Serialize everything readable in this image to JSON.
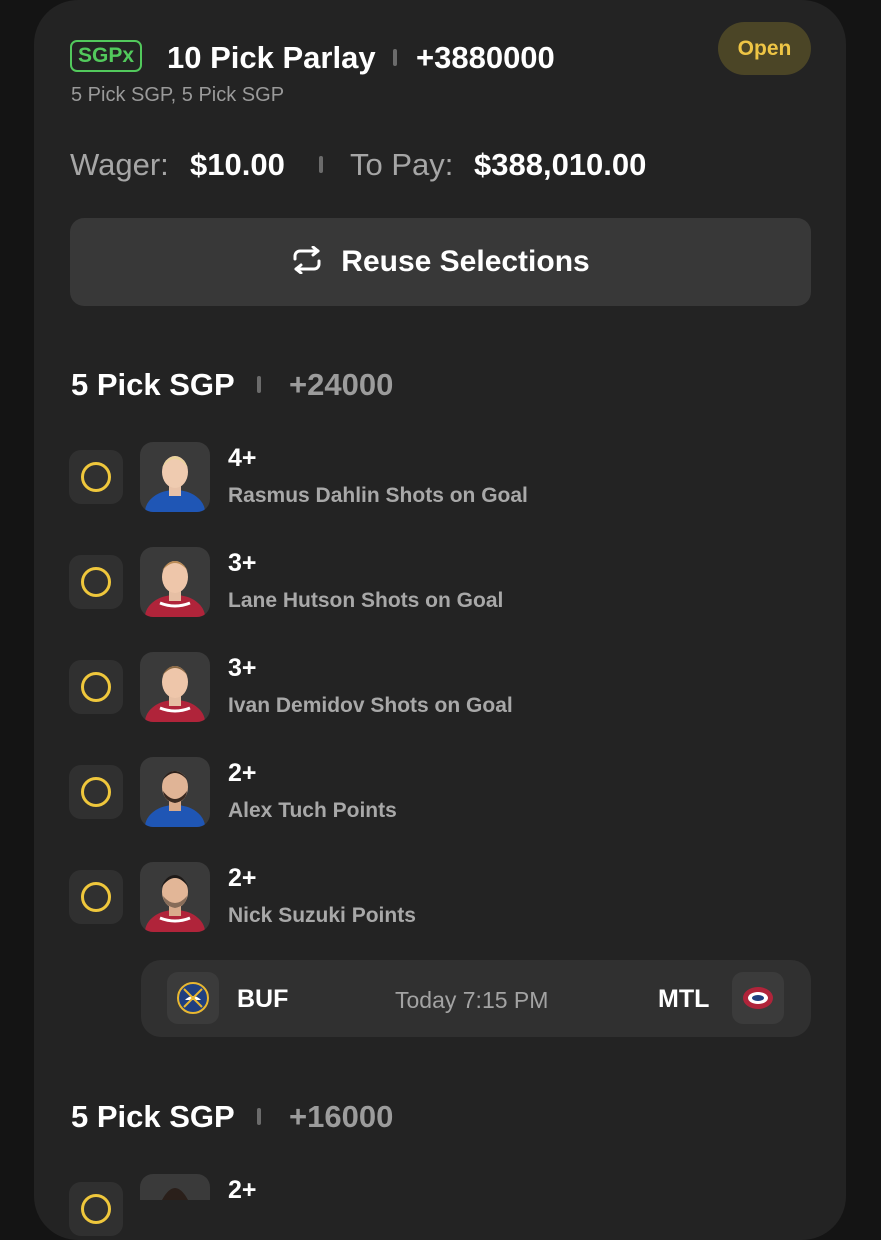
{
  "parlay": {
    "badge": "SGPx",
    "title": "10 Pick Parlay",
    "odds": "+3880000",
    "subtitle": "5 Pick SGP, 5 Pick SGP",
    "status": "Open",
    "wager_label": "Wager:",
    "wager_value": "$10.00",
    "topay_label": "To Pay:",
    "topay_value": "$388,010.00"
  },
  "actions": {
    "reuse_label": "Reuse Selections",
    "reuse_icon": "repeat-icon"
  },
  "sections": [
    {
      "title": "5 Pick SGP",
      "odds": "+24000",
      "legs": [
        {
          "line": "4+",
          "desc": "Rasmus Dahlin Shots on Goal",
          "team": "BUF"
        },
        {
          "line": "3+",
          "desc": "Lane Hutson Shots on Goal",
          "team": "MTL"
        },
        {
          "line": "3+",
          "desc": "Ivan Demidov Shots on Goal",
          "team": "MTL"
        },
        {
          "line": "2+",
          "desc": "Alex Tuch Points",
          "team": "BUF"
        },
        {
          "line": "2+",
          "desc": "Nick Suzuki Points",
          "team": "MTL"
        }
      ],
      "game": {
        "away": "BUF",
        "time": "Today 7:15 PM",
        "home": "MTL"
      }
    },
    {
      "title": "5 Pick SGP",
      "odds": "+16000",
      "legs": [
        {
          "line": "2+",
          "desc": "",
          "team": "MTL"
        }
      ]
    }
  ],
  "colors": {
    "background": "#141414",
    "card": "#232323",
    "sgpx_green": "#52c95c",
    "open_yellow": "#eec545",
    "ring_yellow": "#efc73c",
    "buf_blue": "#1f56b5",
    "mtl_red": "#b0243a"
  }
}
